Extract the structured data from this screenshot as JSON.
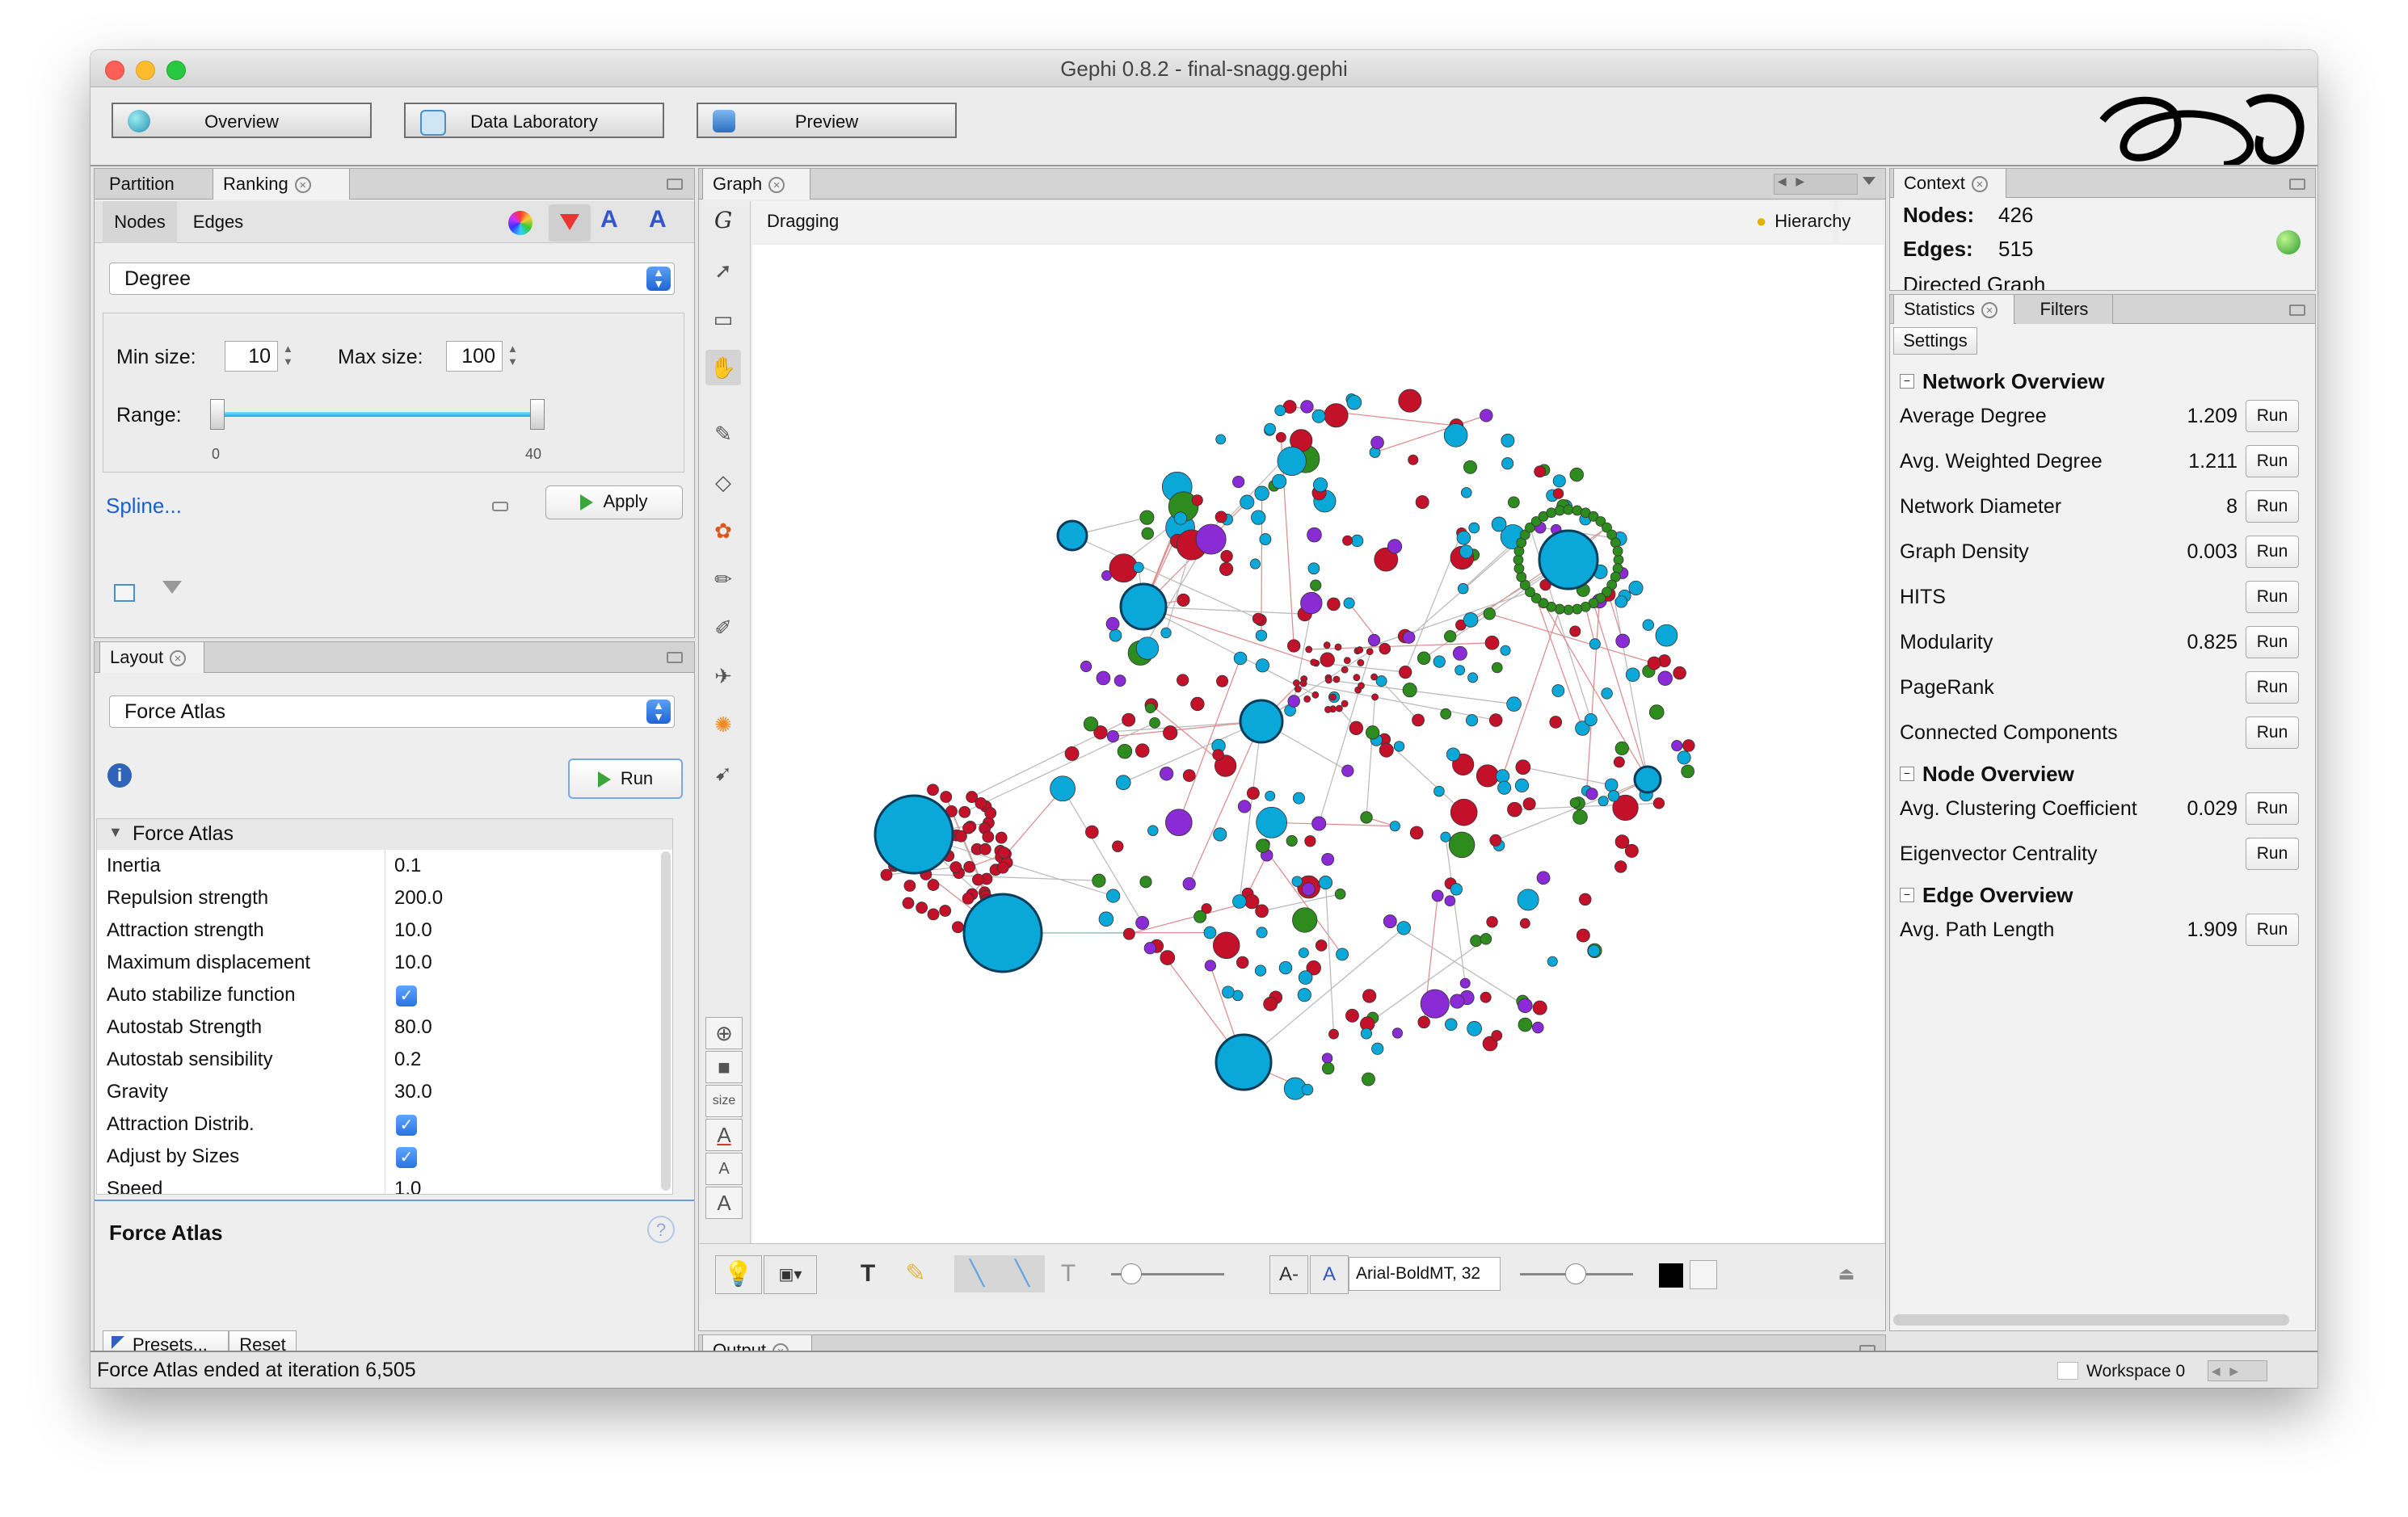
{
  "window": {
    "title": "Gephi 0.8.2 - final-snagg.gephi"
  },
  "toolbar": {
    "overview": "Overview",
    "data_laboratory": "Data Laboratory",
    "preview": "Preview"
  },
  "ranking": {
    "tabs": [
      "Partition",
      "Ranking"
    ],
    "subtabs": [
      "Nodes",
      "Edges"
    ],
    "attribute": "Degree",
    "min_size_label": "Min size:",
    "min_size": "10",
    "max_size_label": "Max size:",
    "max_size": "100",
    "range_label": "Range:",
    "range_min": "0",
    "range_max": "40",
    "spline_label": "Spline...",
    "apply_label": "Apply"
  },
  "layout": {
    "tab": "Layout",
    "algorithm": "Force Atlas",
    "run_label": "Run",
    "section": "Force Atlas",
    "properties": [
      {
        "name": "Inertia",
        "value": "0.1"
      },
      {
        "name": "Repulsion strength",
        "value": "200.0"
      },
      {
        "name": "Attraction strength",
        "value": "10.0"
      },
      {
        "name": "Maximum displacement",
        "value": "10.0"
      },
      {
        "name": "Auto stabilize function",
        "value": "",
        "checked": true
      },
      {
        "name": "Autostab Strength",
        "value": "80.0"
      },
      {
        "name": "Autostab sensibility",
        "value": "0.2"
      },
      {
        "name": "Gravity",
        "value": "30.0"
      },
      {
        "name": "Attraction Distrib.",
        "value": "",
        "checked": true
      },
      {
        "name": "Adjust by Sizes",
        "value": "",
        "checked": true
      },
      {
        "name": "Speed",
        "value": "1.0"
      }
    ],
    "description_title": "Force Atlas",
    "presets_label": "Presets...",
    "reset_label": "Reset"
  },
  "graph": {
    "tab": "Graph",
    "mode": "Dragging",
    "hierarchy": "Hierarchy",
    "size_label": "size",
    "font_label": "Arial-BoldMT, 32"
  },
  "context": {
    "tab": "Context",
    "nodes_label": "Nodes:",
    "nodes": "426",
    "edges_label": "Edges:",
    "edges": "515",
    "graph_type": "Directed Graph"
  },
  "statistics": {
    "tabs": [
      "Statistics",
      "Filters"
    ],
    "settings_label": "Settings",
    "run_label": "Run",
    "sections": [
      {
        "title": "Network Overview",
        "items": [
          {
            "name": "Average Degree",
            "value": "1.209"
          },
          {
            "name": "Avg. Weighted Degree",
            "value": "1.211"
          },
          {
            "name": "Network Diameter",
            "value": "8"
          },
          {
            "name": "Graph Density",
            "value": "0.003"
          },
          {
            "name": "HITS",
            "value": ""
          },
          {
            "name": "Modularity",
            "value": "0.825"
          },
          {
            "name": "PageRank",
            "value": ""
          },
          {
            "name": "Connected Components",
            "value": ""
          }
        ]
      },
      {
        "title": "Node Overview",
        "items": [
          {
            "name": "Avg. Clustering Coefficient",
            "value": "0.029"
          },
          {
            "name": "Eigenvector Centrality",
            "value": ""
          }
        ]
      },
      {
        "title": "Edge Overview",
        "items": [
          {
            "name": "Avg. Path Length",
            "value": "1.909"
          }
        ]
      }
    ]
  },
  "output": {
    "tab": "Output"
  },
  "status": {
    "message": "Force Atlas ended at iteration 6,505",
    "workspace": "Workspace 0"
  },
  "colors": {
    "blue_nodes": "#0aa8d8",
    "green_nodes": "#2e8b1e",
    "red_nodes": "#c4112a",
    "purple_nodes": "#8a2bd6"
  }
}
